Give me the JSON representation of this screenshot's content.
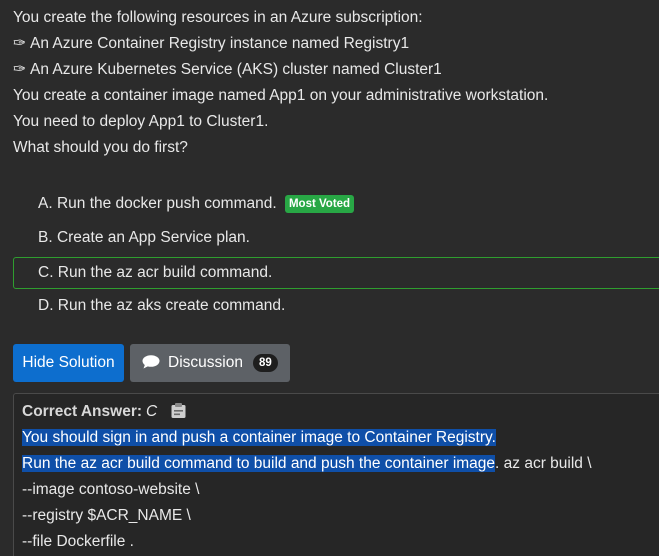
{
  "question": {
    "intro": "You create the following resources in an Azure subscription:",
    "bullet_glyph": "✑",
    "items": [
      "An Azure Container Registry instance named Registry1",
      "An Azure Kubernetes Service (AKS) cluster named Cluster1"
    ],
    "line3": "You create a container image named App1 on your administrative workstation.",
    "line4": "You need to deploy App1 to Cluster1.",
    "line5": "What should you do first?"
  },
  "choices": [
    {
      "text": "A. Run the docker push command.",
      "badge": "Most Voted"
    },
    {
      "text": "B. Create an App Service plan."
    },
    {
      "text": "C. Run the az acr build command."
    },
    {
      "text": "D. Run the az aks create command."
    }
  ],
  "buttons": {
    "hide_solution": "Hide Solution",
    "discussion": "Discussion",
    "discussion_count": "89"
  },
  "answer": {
    "label": "Correct Answer:",
    "letter": "C",
    "line1": "You should sign in and push a container image to Container Registry.",
    "line2_highlight": "Run the az acr build command to build and push the container image",
    "line2_rest": ". az acr build \\",
    "line3": "--image contoso-website \\",
    "line4": "--registry $ACR_NAME \\",
    "line5": "--file Dockerfile ."
  },
  "colors": {
    "background": "#2b2b2b",
    "correct_border": "#2f9e2f",
    "badge": "#28a745",
    "primary_button": "#0d6ece",
    "highlight": "#0f4fa8"
  }
}
